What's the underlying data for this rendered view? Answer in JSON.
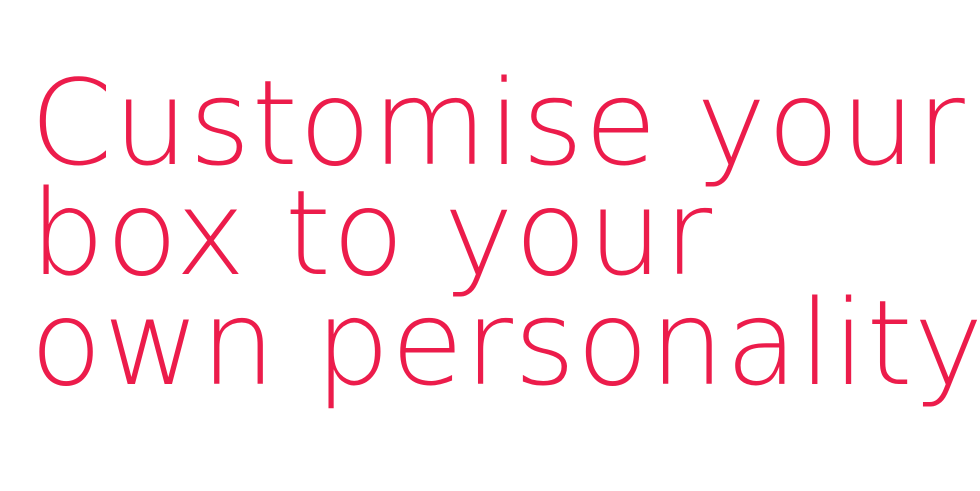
{
  "headline": {
    "lines": [
      "Customise your",
      "box to your",
      "own personality"
    ],
    "color": "#ec1c4b"
  }
}
